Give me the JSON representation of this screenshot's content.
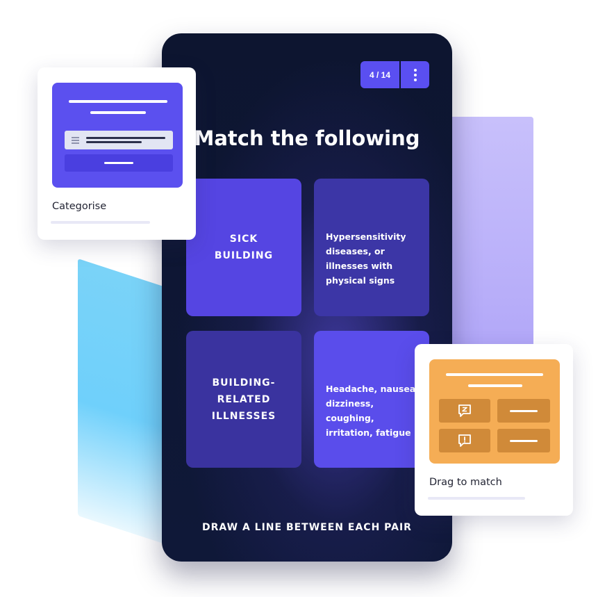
{
  "quiz": {
    "counter": "4 / 14",
    "title": "Match the following",
    "cards": [
      {
        "text": "SICK\nBUILDING",
        "kind": "term"
      },
      {
        "text": "Hypersensitivity diseases, or illnesses with physical signs",
        "kind": "definition"
      },
      {
        "text": "BUILDING-\nRELATED\nILLNESSES",
        "kind": "term"
      },
      {
        "text": "Headache, nausea, dizziness, coughing, irritation, fatigue",
        "kind": "definition"
      }
    ],
    "instruction": "DRAW A LINE BETWEEN EACH PAIR"
  },
  "templates": {
    "categorise": {
      "label": "Categorise"
    },
    "drag_to_match": {
      "label": "Drag to match"
    }
  },
  "colors": {
    "primary": "#5a4ff1",
    "phone_bg": "#0d1530",
    "orange": "#f5ad55",
    "sky": "#7ad3f8",
    "lavender": "#c8c0fb"
  }
}
